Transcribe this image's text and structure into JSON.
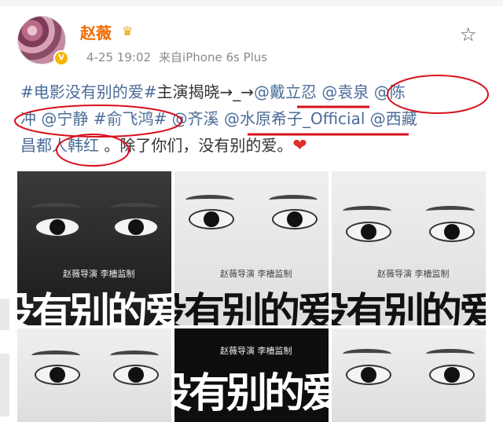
{
  "post": {
    "username": "赵薇",
    "time": "4-25 19:02",
    "source": "来自iPhone 6s Plus",
    "lines": [
      [
        [
          "#电影没有别的爱#",
          "link"
        ],
        [
          "主演揭晓→_→",
          "plain"
        ],
        [
          "@戴立忍",
          "link"
        ],
        [
          " ",
          "plain"
        ],
        [
          "@袁泉",
          "link"
        ],
        [
          " ",
          "plain"
        ],
        [
          "@陈",
          "link"
        ]
      ],
      [
        [
          "冲",
          "link"
        ],
        [
          " ",
          "plain"
        ],
        [
          "@宁静",
          "link"
        ],
        [
          " ",
          "plain"
        ],
        [
          "#俞飞鸿#",
          "link"
        ],
        [
          " ",
          "plain"
        ],
        [
          "@齐溪",
          "link"
        ],
        [
          " ",
          "plain"
        ],
        [
          "@水原希子_Official",
          "link"
        ],
        [
          " ",
          "plain"
        ],
        [
          "@西藏",
          "link"
        ]
      ],
      [
        [
          "昌都",
          "link"
        ],
        [
          "人韩红",
          "link"
        ],
        [
          " 。除了你们，没有别的爱。",
          "plain"
        ]
      ]
    ],
    "heart": "❤"
  },
  "posters": {
    "credit_director": "赵薇导演",
    "credit_producer": "李檣监制",
    "title_fragment": "没有别的爱"
  },
  "colors": {
    "username": "#f06b00",
    "link": "#4b6c98",
    "annotation": "#d8101c"
  }
}
